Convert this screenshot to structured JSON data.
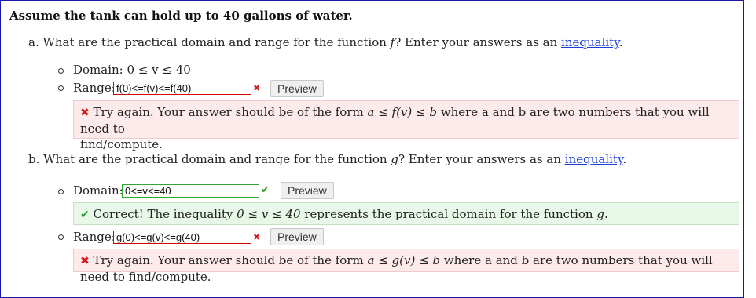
{
  "problem": {
    "intro": "Assume the tank can hold up to 40 gallons of water."
  },
  "part_a": {
    "prefix": "a. What are the practical domain and range for the function ",
    "func": "f",
    "suffix": "? Enter your answers as an ",
    "link": "inequality",
    "end": ".",
    "domain_label": "Domain: ",
    "domain_value": "0 ≤ v ≤ 40",
    "range_label": "Range: ",
    "range_input": "f(0)<=f(v)<=f(40)",
    "preview_label": "Preview",
    "range_feedback_1": " Try again. Your answer should be of the form ",
    "range_feedback_expr": "a ≤ f(v) ≤ b",
    "range_feedback_2": " where a and b are two numbers that you will need to",
    "range_feedback_3": "find/compute."
  },
  "part_b": {
    "prefix": "b. What are the practical domain and range for the function ",
    "func": "g",
    "suffix": "? Enter your answers as an ",
    "link": "inequality",
    "end": ".",
    "domain_label": "Domain: ",
    "domain_input": "0<=v<=40",
    "domain_preview_label": "Preview",
    "domain_feedback_1": " Correct! The inequality ",
    "domain_feedback_expr": "0 ≤ v ≤ 40",
    "domain_feedback_2": " represents the practical domain for the function ",
    "domain_feedback_func": "g",
    "domain_feedback_end": ".",
    "range_label": "Range: ",
    "range_input": "g(0)<=g(v)<=g(40)",
    "range_preview_label": "Preview",
    "range_feedback_1": " Try again. Your answer should be of the form ",
    "range_feedback_expr": "a ≤ g(v) ≤ b",
    "range_feedback_2": " where a and b are two numbers that you will need to find/compute."
  },
  "icons": {
    "error": "x-mark-icon",
    "success": "check-mark-icon"
  },
  "colors": {
    "link": "#1a3fd6",
    "error": "#d40000",
    "success": "#2ea82e",
    "error_bg": "#fdeaea",
    "success_bg": "#e8f8e8"
  }
}
